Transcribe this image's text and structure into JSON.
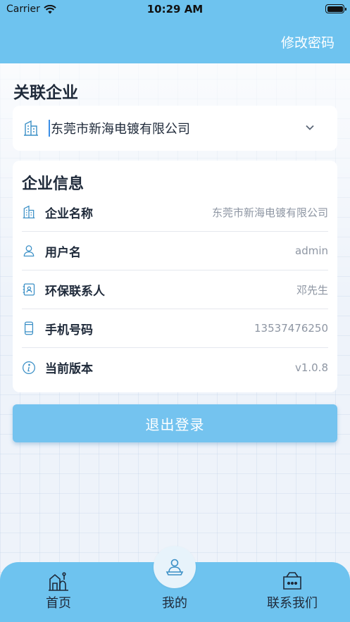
{
  "status_bar": {
    "carrier": "Carrier",
    "time": "10:29 AM"
  },
  "header": {
    "action_label": "修改密码"
  },
  "linked_company": {
    "section_title": "关联企业",
    "selected_company": "东莞市新海电镀有限公司"
  },
  "info": {
    "title": "企业信息",
    "rows": [
      {
        "label": "企业名称",
        "value": "东莞市新海电镀有限公司",
        "icon": "building-icon"
      },
      {
        "label": "用户名",
        "value": "admin",
        "icon": "user-icon"
      },
      {
        "label": "环保联系人",
        "value": "邓先生",
        "icon": "contact-book-icon"
      },
      {
        "label": "手机号码",
        "value": "13537476250",
        "icon": "phone-icon"
      },
      {
        "label": "当前版本",
        "value": "v1.0.8",
        "icon": "info-icon"
      }
    ]
  },
  "logout_label": "退出登录",
  "tabs": [
    {
      "label": "首页",
      "icon": "home-icon"
    },
    {
      "label": "我的",
      "icon": "profile-icon"
    },
    {
      "label": "联系我们",
      "icon": "chat-icon"
    }
  ],
  "colors": {
    "accent": "#6ec3ef",
    "button": "#74c3ef",
    "icon": "#3a8fc6"
  }
}
